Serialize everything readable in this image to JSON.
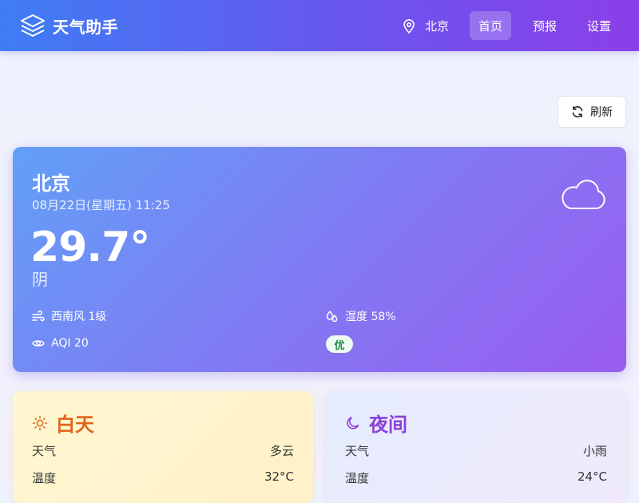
{
  "app": {
    "name": "天气助手"
  },
  "nav": {
    "location": "北京",
    "items": [
      {
        "label": "首页",
        "active": true
      },
      {
        "label": "预报",
        "active": false
      },
      {
        "label": "设置",
        "active": false
      }
    ]
  },
  "toolbar": {
    "refresh_label": "刷新"
  },
  "current": {
    "city": "北京",
    "datetime": "08月22日(星期五) 11:25",
    "temperature": "29.7°",
    "condition": "阴",
    "icon": "cloud-icon",
    "wind": "西南风 1级",
    "humidity": "湿度 58%",
    "aqi": "AQI 20",
    "aqi_level": "优"
  },
  "day": {
    "title": "白天",
    "icon": "sun-icon",
    "rows": [
      {
        "label": "天气",
        "value": "多云"
      },
      {
        "label": "温度",
        "value": "32°C"
      }
    ]
  },
  "night": {
    "title": "夜间",
    "icon": "moon-icon",
    "rows": [
      {
        "label": "天气",
        "value": "小雨"
      },
      {
        "label": "温度",
        "value": "24°C"
      }
    ]
  },
  "colors": {
    "header_start": "#3e7df5",
    "header_end": "#8b3fe9",
    "day_title": "#e0641a",
    "night_title": "#8a3fd6",
    "aqi_good": "#1e8a43"
  }
}
